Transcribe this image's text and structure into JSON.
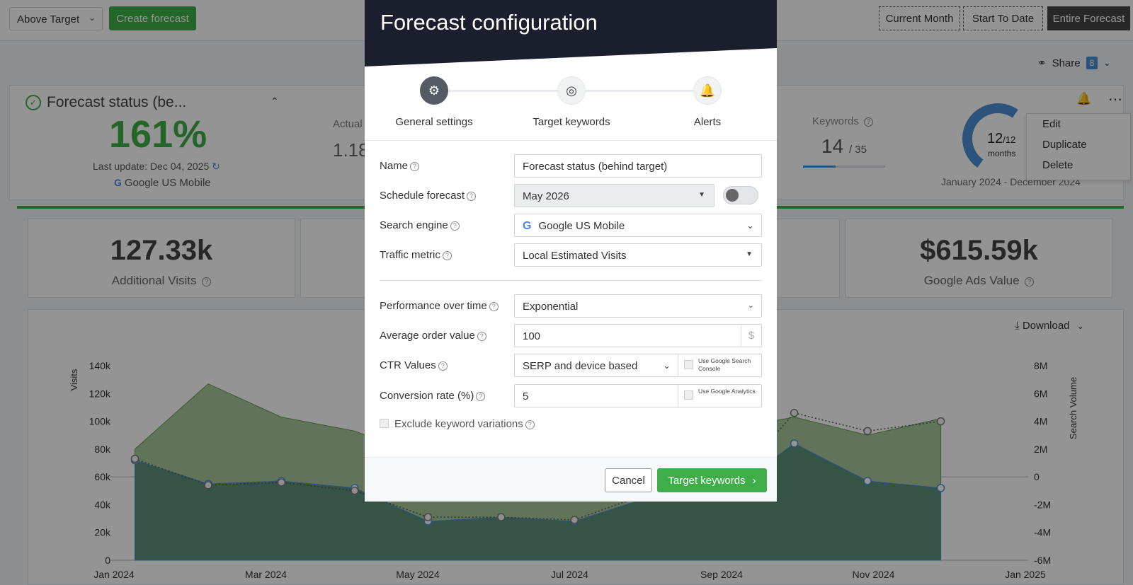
{
  "topbar": {
    "segment_select": "Above Target",
    "create_label": "Create forecast",
    "range_buttons": [
      "Current Month",
      "Start To Date",
      "Entire Forecast"
    ]
  },
  "share": {
    "label": "Share",
    "count": "8"
  },
  "status": {
    "title": "Forecast status (be...",
    "percent": "161%",
    "last_update": "Last update: Dec 04, 2025",
    "engine": "Google US Mobile",
    "actual_label": "Actual",
    "actual_value": "1.18",
    "keywords_label": "Keywords",
    "keywords_value": "14",
    "keywords_total": "/ 35",
    "keywords_fill": 0.4,
    "months_value": "12",
    "months_total": "/12",
    "months_label": "months",
    "date_range": "January 2024 - December 2024"
  },
  "context_menu": [
    "Edit",
    "Duplicate",
    "Delete"
  ],
  "metrics": [
    {
      "value": "127.33k",
      "label": "Additional Visits"
    },
    {
      "value": "$615.59k",
      "label": "Google Ads Value"
    }
  ],
  "chart_card": {
    "download_label": "Download"
  },
  "chart_data": {
    "type": "area",
    "x_ticks": [
      "Jan 2024",
      "Mar 2024",
      "May 2024",
      "Jul 2024",
      "Sep 2024",
      "Nov 2024",
      "Jan 2025"
    ],
    "y_left_ticks": [
      "0",
      "20k",
      "40k",
      "60k",
      "80k",
      "100k",
      "120k",
      "140k"
    ],
    "y_right_ticks": [
      "-6M",
      "-4M",
      "-2M",
      "0",
      "2M",
      "4M",
      "6M",
      "8M"
    ],
    "ylabel_left": "Visits",
    "ylabel_right": "Search Volume",
    "ylim_left": [
      0,
      140000
    ],
    "ylim_right": [
      -6000000,
      8000000
    ],
    "x_months": [
      1,
      2,
      3,
      4,
      5,
      6,
      7,
      8,
      9,
      10,
      11,
      12
    ],
    "series": [
      {
        "values": [
          80000,
          127000,
          103000,
          93000,
          73000,
          73000,
          73000,
          73000,
          93000,
          103000,
          90000,
          102000
        ]
      },
      {
        "values": [
          72000,
          55000,
          57000,
          52000,
          28000,
          31000,
          28000,
          45000,
          45000,
          84000,
          57000,
          52000
        ]
      },
      {
        "values": [
          73000,
          54000,
          56000,
          50000,
          31000,
          31000,
          29000,
          48000,
          46000,
          106000,
          93000,
          100000
        ]
      }
    ],
    "colors": {
      "upper": "#a8c89a",
      "lower": "#5e8f7a",
      "line": "#4b8fd6",
      "dotted": "#555555"
    }
  },
  "modal": {
    "title": "Forecast configuration",
    "steps": [
      {
        "label": "General settings",
        "icon": "gear-icon"
      },
      {
        "label": "Target keywords",
        "icon": "target-icon"
      },
      {
        "label": "Alerts",
        "icon": "bell-icon"
      }
    ],
    "fields": {
      "name": {
        "label": "Name",
        "value": "Forecast status (behind target)"
      },
      "schedule": {
        "label": "Schedule forecast",
        "value": "May 2026"
      },
      "engine": {
        "label": "Search engine",
        "value": "Google US Mobile"
      },
      "traffic": {
        "label": "Traffic metric",
        "value": "Local Estimated Visits"
      },
      "performance": {
        "label": "Performance over time",
        "value": "Exponential"
      },
      "aov": {
        "label": "Average order value",
        "value": "100",
        "unit": "$"
      },
      "ctr": {
        "label": "CTR Values",
        "value": "SERP and device based",
        "check_label": "Use Google Search Console"
      },
      "conversion": {
        "label": "Conversion rate (%)",
        "value": "5",
        "check_label": "Use Google Analytics"
      },
      "exclude": {
        "label": "Exclude keyword variations"
      }
    },
    "cancel_label": "Cancel",
    "next_label": "Target keywords"
  }
}
